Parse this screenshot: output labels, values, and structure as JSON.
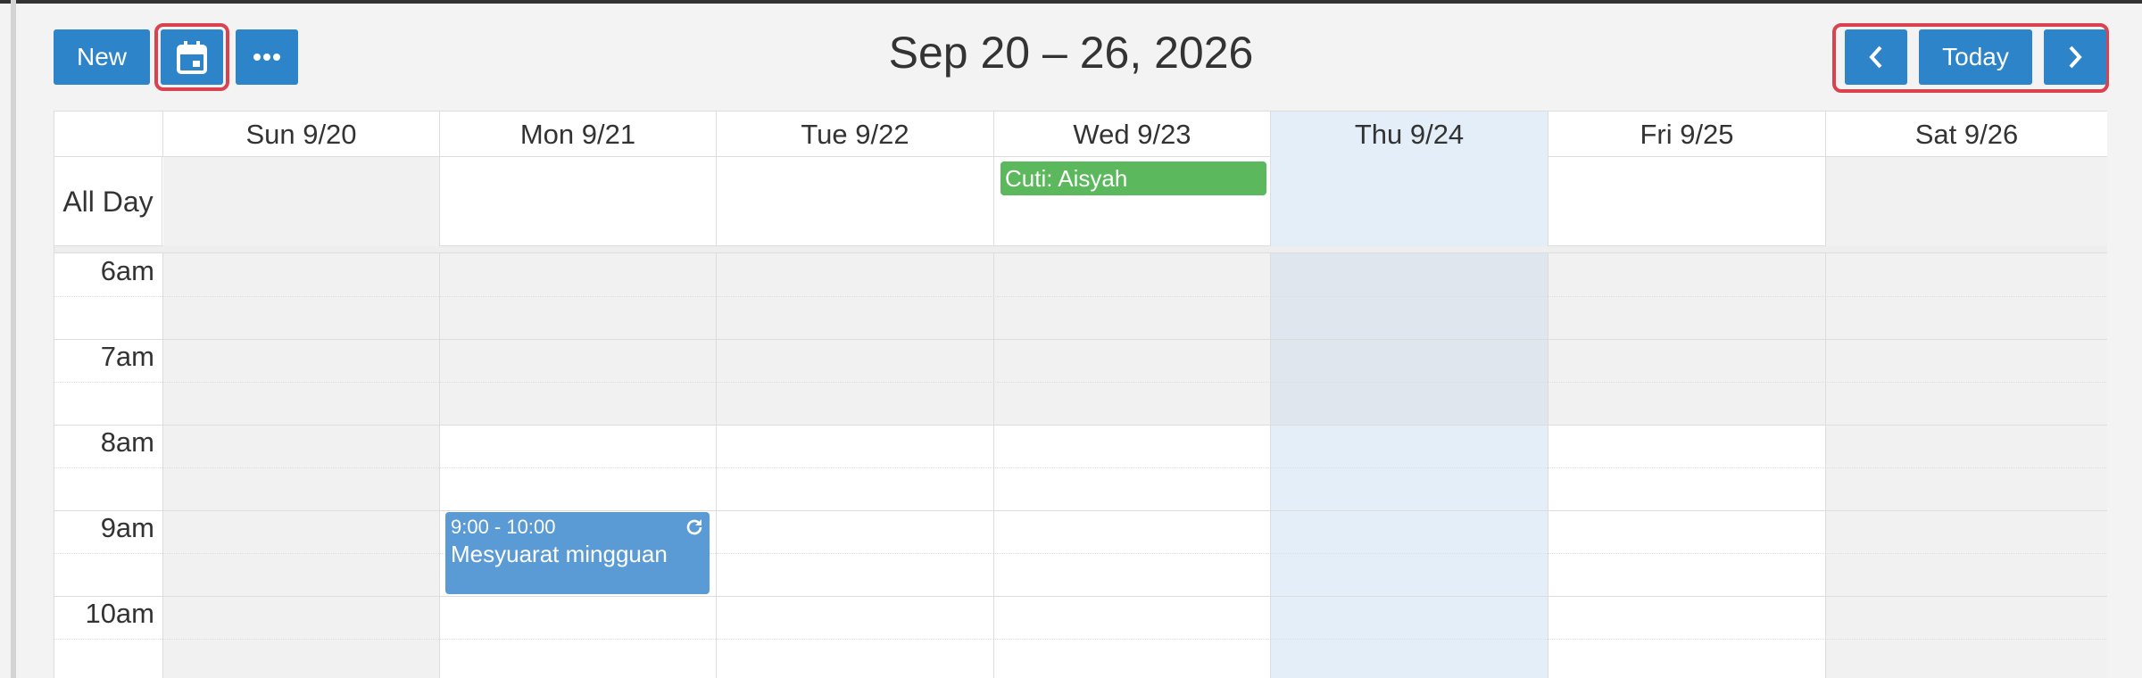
{
  "toolbar": {
    "new_label": "New",
    "title": "Sep 20 – 26, 2026",
    "today_label": "Today"
  },
  "days": [
    {
      "label": "Sun 9/20"
    },
    {
      "label": "Mon 9/21"
    },
    {
      "label": "Tue 9/22"
    },
    {
      "label": "Wed 9/23"
    },
    {
      "label": "Thu 9/24"
    },
    {
      "label": "Fri 9/25"
    },
    {
      "label": "Sat 9/26"
    }
  ],
  "allday_label": "All Day",
  "times": [
    "6am",
    "7am",
    "8am",
    "9am",
    "10am"
  ],
  "events": {
    "allday": {
      "text": "Cuti: Aisyah",
      "color": "#5cb85c"
    },
    "meeting": {
      "time": "9:00 - 10:00",
      "title": "Mesyuarat mingguan",
      "color": "#5b9bd5",
      "recurring_icon": "refresh-icon"
    }
  },
  "colors": {
    "accent": "#2e84c8",
    "highlight": "#d9434f",
    "today_bg": "#e3eef8"
  }
}
